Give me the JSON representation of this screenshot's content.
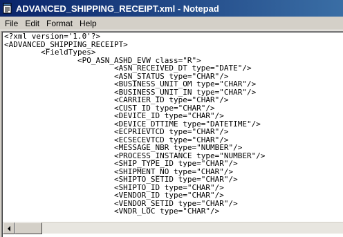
{
  "window": {
    "title": "ADVANCED_SHIPPING_RECEIPT.xml - Notepad",
    "app_icon": "notepad-icon"
  },
  "menu": {
    "items": [
      "File",
      "Edit",
      "Format",
      "Help"
    ]
  },
  "editor": {
    "lines": [
      "<?xml version='1.0'?>",
      "<ADVANCED_SHIPPING_RECEIPT>",
      "        <FieldTypes>",
      "                <PO_ASN_ASHD_EVW class=\"R\">",
      "                        <ASN_RECEIVED_DT type=\"DATE\"/>",
      "                        <ASN_STATUS type=\"CHAR\"/>",
      "                        <BUSINESS_UNIT_OM type=\"CHAR\"/>",
      "                        <BUSINESS_UNIT_IN type=\"CHAR\"/>",
      "                        <CARRIER_ID type=\"CHAR\"/>",
      "                        <CUST_ID type=\"CHAR\"/>",
      "                        <DEVICE_ID type=\"CHAR\"/>",
      "                        <DEVICE_DTTIME type=\"DATETIME\"/>",
      "                        <ECPRIEVTCD type=\"CHAR\"/>",
      "                        <ECSECEVTCD type=\"CHAR\"/>",
      "                        <MESSAGE_NBR type=\"NUMBER\"/>",
      "                        <PROCESS_INSTANCE type=\"NUMBER\"/>",
      "                        <SHIP_TYPE_ID type=\"CHAR\"/>",
      "                        <SHIPMENT_NO type=\"CHAR\"/>",
      "                        <SHIPTO_SETID type=\"CHAR\"/>",
      "                        <SHIPTO_ID type=\"CHAR\"/>",
      "                        <VENDOR_ID type=\"CHAR\"/>",
      "                        <VENDOR_SETID type=\"CHAR\"/>",
      "                        <VNDR_LOC type=\"CHAR\"/>"
    ]
  },
  "scrollbar": {
    "left_arrow_icon": "left-arrow-icon"
  }
}
